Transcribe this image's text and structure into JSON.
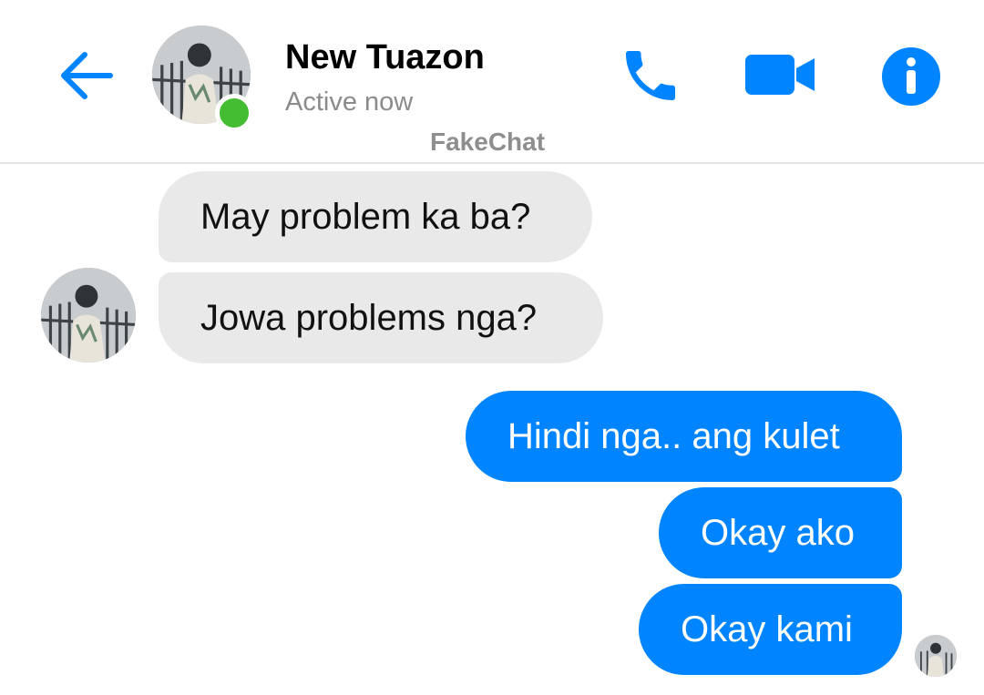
{
  "header": {
    "contact_name": "New Tuazon",
    "status": "Active now",
    "watermark": "FakeChat",
    "icons": {
      "back": "back-arrow-icon",
      "call": "phone-icon",
      "video": "video-camera-icon",
      "info": "info-icon"
    }
  },
  "messages": [
    {
      "from": "contact",
      "text": "May problem ka ba?"
    },
    {
      "from": "contact",
      "text": "Jowa problems nga?"
    },
    {
      "from": "me",
      "text": "Hindi nga.. ang kulet"
    },
    {
      "from": "me",
      "text": "Okay ako"
    },
    {
      "from": "me",
      "text": "Okay kami"
    }
  ],
  "colors": {
    "accent": "#0184ff",
    "incoming_bubble": "#e9e9e9",
    "online": "#44bd32",
    "status_text": "#8b8b8b"
  }
}
